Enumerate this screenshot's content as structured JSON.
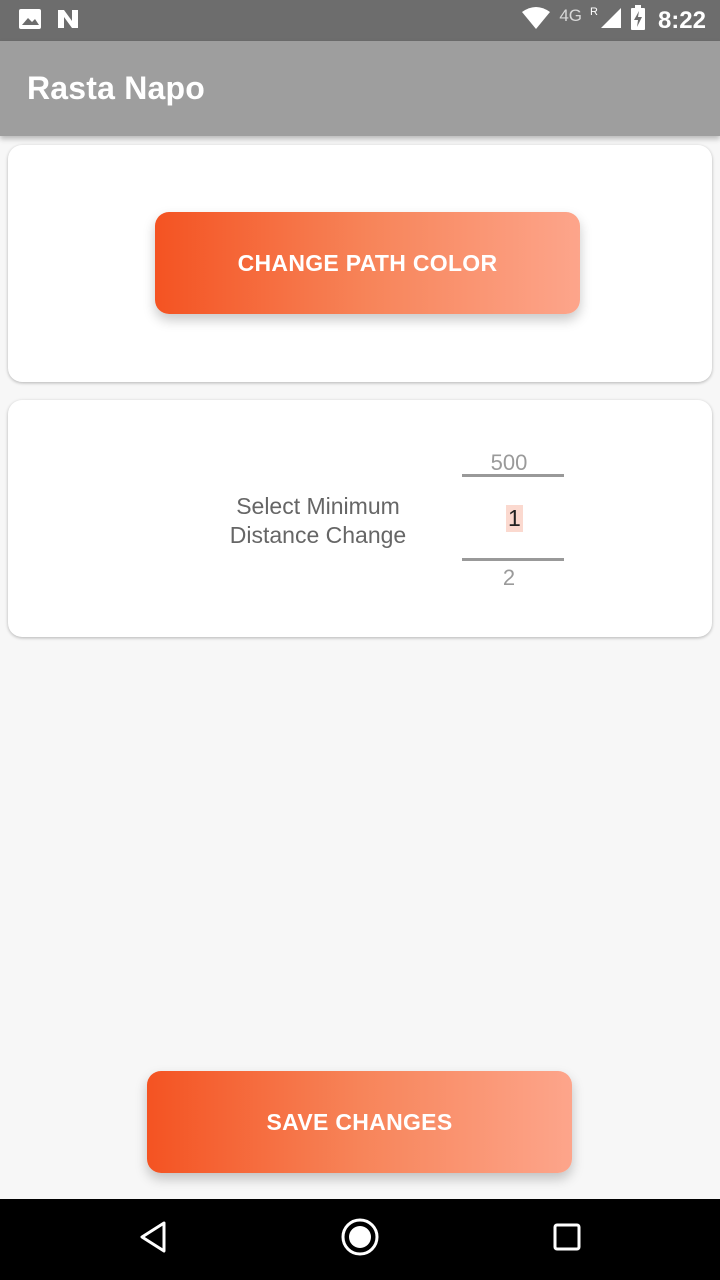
{
  "status_bar": {
    "time": "8:22",
    "network": "4G",
    "roaming": "R",
    "icons": [
      "image-icon",
      "n-app-icon",
      "wifi-icon",
      "signal-icon",
      "battery-charging-icon"
    ]
  },
  "app_bar": {
    "title": "Rasta Napo"
  },
  "path_card": {
    "change_color_label": "CHANGE PATH COLOR"
  },
  "distance_card": {
    "label": "Select Minimum Distance Change",
    "picker": {
      "previous": "500",
      "current": "1",
      "next": "2"
    }
  },
  "footer": {
    "save_label": "SAVE CHANGES"
  },
  "nav_bar": {
    "icons": [
      "back-icon",
      "home-icon",
      "recents-icon"
    ]
  },
  "colors": {
    "gradient_start": "#f45322",
    "gradient_end": "#fda58b",
    "app_bar": "#9e9e9e",
    "status_bar": "#6d6d6d",
    "picker_highlight": "#fbd9cf"
  }
}
